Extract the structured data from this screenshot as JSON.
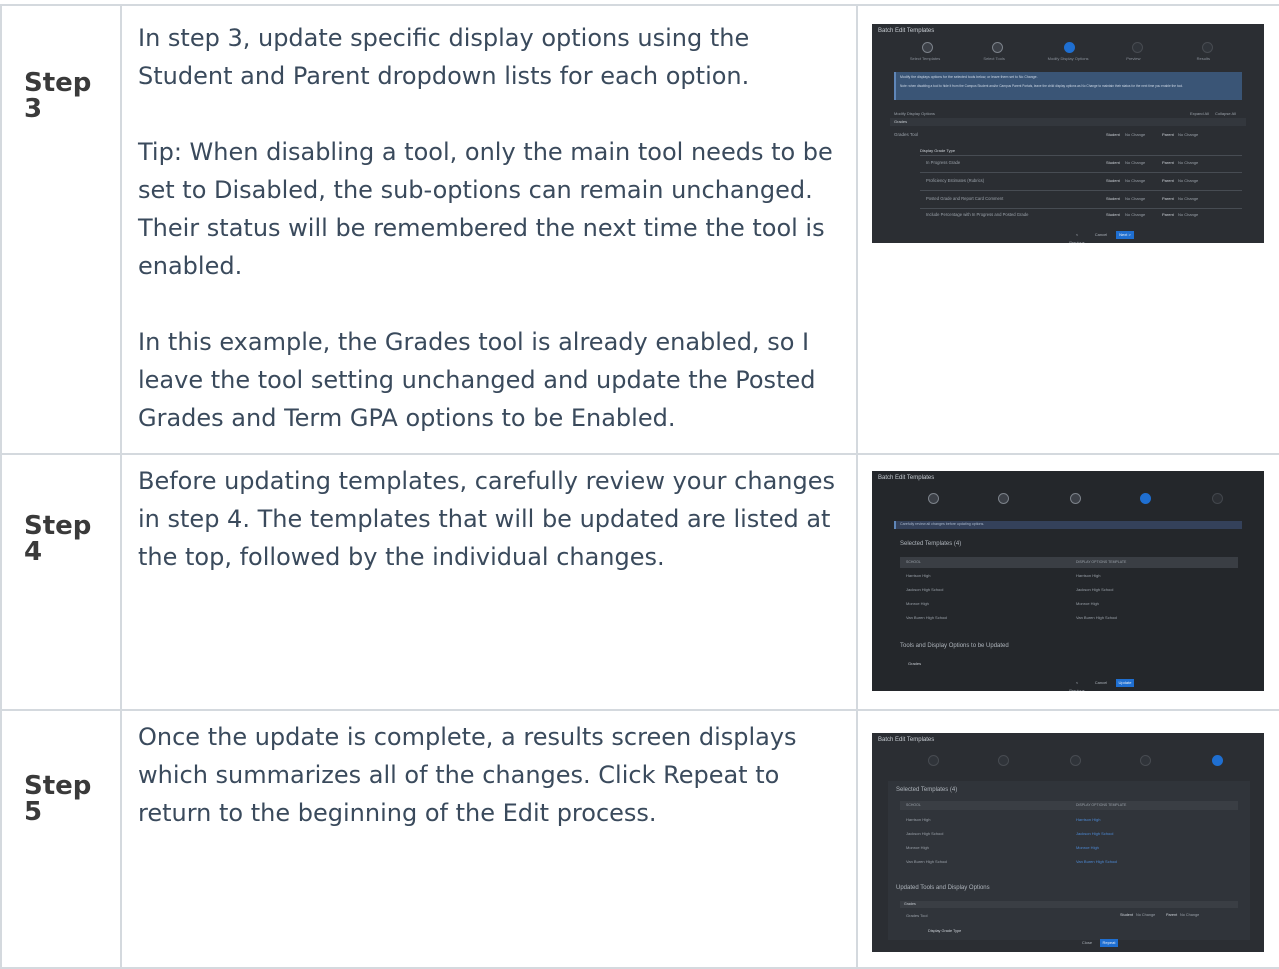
{
  "rows": [
    {
      "step": "Step 3",
      "paragraphs": [
        "In step 3, update specific display options using the Student and Parent dropdown lists for each option.",
        "Tip: When disabling a tool, only the main tool needs to be set to Disabled, the sub-options can remain unchanged. Their status will be remembered the next time the tool is enabled.",
        "In this example, the Grades tool is already enabled, so I leave the tool setting unchanged and update the Posted Grades and Term GPA options to be Enabled."
      ],
      "screenshot": {
        "title": "Batch Edit Templates",
        "steps": [
          "Select Templates",
          "Select Tools",
          "Modify Display Options",
          "Preview",
          "Results"
        ],
        "banner1": "Modify the displays options for the selected tools below, or leave them set to No Change.",
        "banner2": "Note: when disabling a tool to hide it from the Campus Student and/or Campus Parent Portals, leave the child display options as No Change to maintain their status for the next time you enable the tool.",
        "section": "Modify Display Options",
        "expand": "Expand All",
        "collapse": "Collapse All",
        "group": "Grades",
        "tool": "Grades Tool",
        "subhead": "Display Grade Type",
        "options": [
          "In Progress Grade",
          "Proficiency Estimates (Rubrics)",
          "Posted Grade and Report Card Comment",
          "Include Percentage with In Progress and Posted Grade"
        ],
        "student": "Student",
        "parent": "Parent",
        "nochange": "No Change",
        "prev": "< Previous",
        "cancel": "Cancel",
        "next": "Next >"
      }
    },
    {
      "step": "Step 4",
      "paragraphs": [
        "Before updating templates, carefully review your changes in step 4. The templates that will be updated are listed at the top, followed by the individual changes."
      ],
      "screenshot": {
        "title": "Batch Edit Templates",
        "banner": "Carefully review all changes before updating options.",
        "selected": "Selected Templates (4)",
        "col1": "SCHOOL",
        "col2": "DISPLAY OPTIONS TEMPLATE",
        "schools": [
          "Harrison High",
          "Jackson High School",
          "Monroe High",
          "Van Buren High School"
        ],
        "templates": [
          "Harrison High",
          "Jackson High School",
          "Monroe High",
          "Van Buren High School"
        ],
        "tools_heading": "Tools and Display Options to be Updated",
        "group": "Grades",
        "prev": "< Previous",
        "cancel": "Cancel",
        "update": "Update"
      }
    },
    {
      "step": "Step 5",
      "paragraphs": [
        "Once the update is complete, a results screen displays which summarizes all of the changes. Click Repeat to return to the beginning of the Edit process."
      ],
      "screenshot": {
        "title": "Batch Edit Templates",
        "selected": "Selected Templates (4)",
        "col1": "SCHOOL",
        "col2": "DISPLAY OPTIONS TEMPLATE",
        "schools": [
          "Harrison High",
          "Jackson High School",
          "Monroe High",
          "Van Buren High School"
        ],
        "templates": [
          "Harrison High",
          "Jackson High School",
          "Monroe High",
          "Van Buren High School"
        ],
        "updated_heading": "Updated Tools and Display Options",
        "group": "Grades",
        "tool": "Grades Tool",
        "student": "Student",
        "parent": "Parent",
        "nochange": "No Change",
        "subhead": "Display Grade Type",
        "close": "Close",
        "repeat": "Repeat"
      }
    }
  ]
}
